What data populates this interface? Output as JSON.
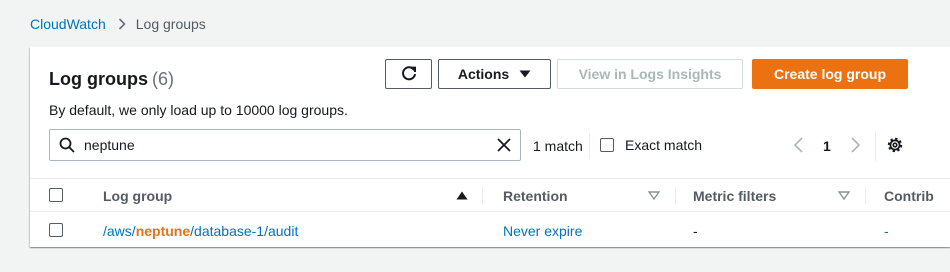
{
  "breadcrumb": {
    "parent": "CloudWatch",
    "current": "Log groups"
  },
  "panel": {
    "title": "Log groups",
    "count": "(6)",
    "description": "By default, we only load up to 10000 log groups."
  },
  "toolbar": {
    "refresh_icon": "refresh-icon",
    "actions_label": "Actions",
    "insights_label": "View in Logs Insights",
    "create_label": "Create log group"
  },
  "search": {
    "value": "neptune",
    "placeholder": ""
  },
  "filter": {
    "match_text": "1 match",
    "exact_match_label": "Exact match"
  },
  "pagination": {
    "current_page": "1"
  },
  "table": {
    "columns": [
      "Log group",
      "Retention",
      "Metric filters",
      "Contrib"
    ],
    "rows": [
      {
        "log_group_prefix": "/aws/",
        "log_group_highlight": "neptune",
        "log_group_suffix": "/database-1/audit",
        "retention": "Never expire",
        "metric_filters": "-",
        "contrib": "-"
      }
    ]
  },
  "colors": {
    "accent": "#ec7211",
    "link": "#0073bb",
    "background": "#f2f3f3"
  }
}
